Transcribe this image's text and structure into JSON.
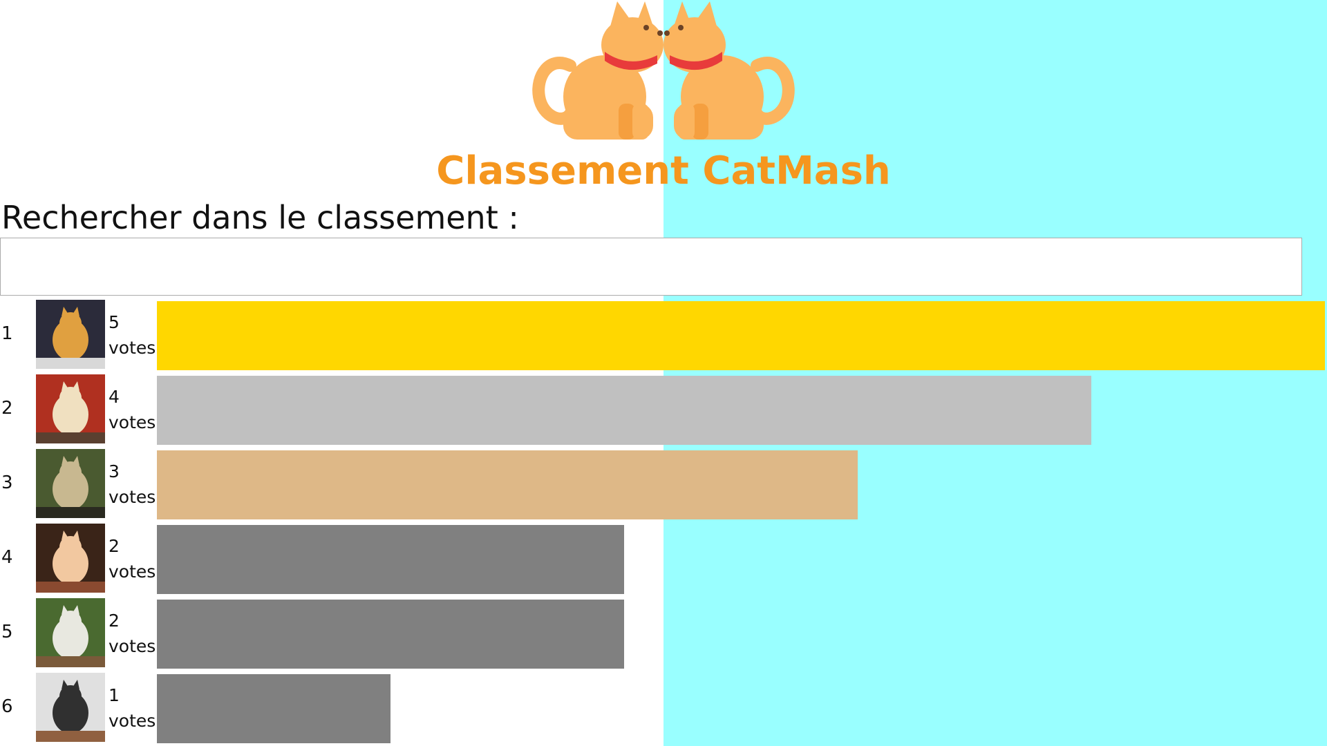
{
  "title": "Classement CatMash",
  "search": {
    "label": "Rechercher dans le classement :",
    "value": "",
    "placeholder": ""
  },
  "colors": {
    "left_bg": "#ffffff",
    "right_bg": "#99ffff",
    "title": "#f5961e",
    "gold": "#ffd700",
    "silver": "#c0c0c0",
    "bronze": "#deb887",
    "other": "#808080"
  },
  "ranking": [
    {
      "rank": "1",
      "votes": "5",
      "votes_label": "votes",
      "color": "#ffd700"
    },
    {
      "rank": "2",
      "votes": "4",
      "votes_label": "votes",
      "color": "#c0c0c0"
    },
    {
      "rank": "3",
      "votes": "3",
      "votes_label": "votes",
      "color": "#deb887"
    },
    {
      "rank": "4",
      "votes": "2",
      "votes_label": "votes",
      "color": "#808080"
    },
    {
      "rank": "5",
      "votes": "2",
      "votes_label": "votes",
      "color": "#808080"
    },
    {
      "rank": "6",
      "votes": "1",
      "votes_label": "votes",
      "color": "#808080"
    }
  ],
  "icons": {
    "logo": "two-cats-logo",
    "thumbs": [
      "cat-dj-photo",
      "cat-blanket-photo",
      "cat-sitting-photo",
      "woman-cat-photo",
      "cat-bridge-photo",
      "cat-box-photo"
    ]
  }
}
